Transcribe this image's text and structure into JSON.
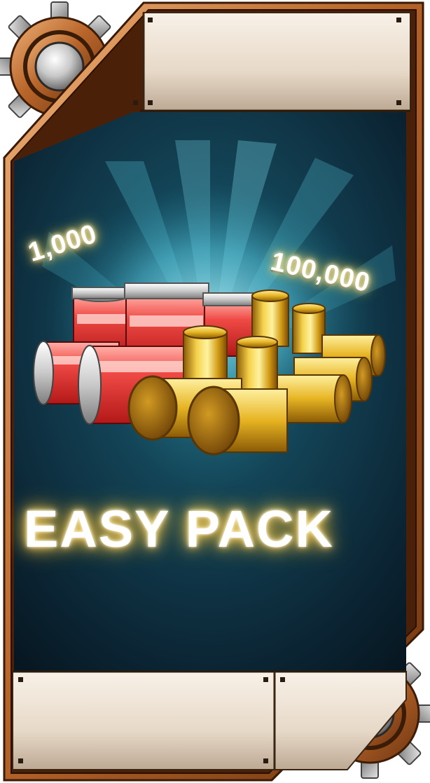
{
  "pack": {
    "title": "EASY PACK",
    "reward_left_amount": "1,000",
    "reward_right_amount": "100,000"
  },
  "icons": {
    "left_reward": "red-energy-canister-icon",
    "right_reward": "gold-bullet-casing-icon",
    "corner_gears": "gear-icon"
  },
  "colors": {
    "frame_bronze": "#b8652a",
    "panel_dark": "#0d2a36",
    "glow": "#ffe07a",
    "gold": "#e6b422",
    "canister_red": "#e23a3a"
  }
}
